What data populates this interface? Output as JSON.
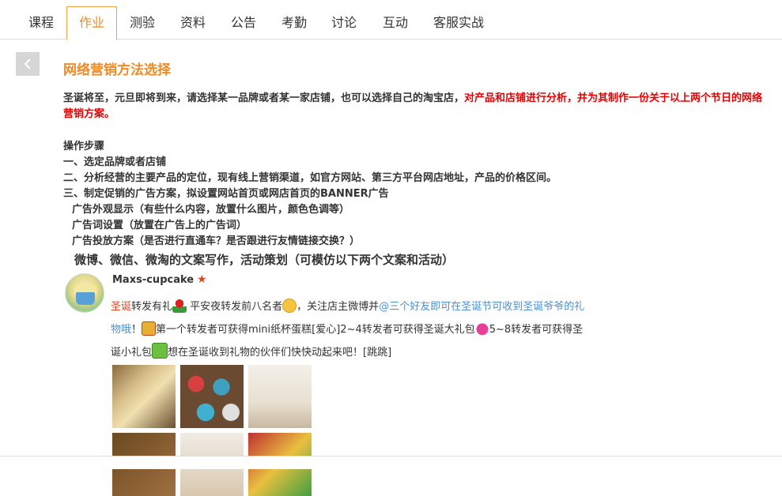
{
  "tabs": [
    "课程",
    "作业",
    "测验",
    "资料",
    "公告",
    "考勤",
    "讨论",
    "互动",
    "客服实战"
  ],
  "active_tab": "作业",
  "title": "网络营销方法选择",
  "intro": {
    "text": "圣诞将至，元旦即将到来，请选择某一品牌或者某一家店铺，也可以选择自己的淘宝店，",
    "highlight": "对产品和店铺进行分析，并为其制作一份关于以上两个节日的网络营销方案。"
  },
  "steps": {
    "heading": "操作步骤",
    "items": [
      "一、选定品牌或者店铺",
      "二、分析经营的主要产品的定位，现有线上营销渠道，如官方网站、第三方平台网店地址，产品的价格区间。",
      "三、制定促销的广告方案，拟设置网站首页或网店首页的BANNER广告"
    ],
    "sub_items": [
      "广告外观显示（有些什么内容，放置什么图片，颜色色调等）",
      "广告词设置（放置在广告上的广告词）",
      "广告投放方案（是否进行直通车？是否跟进行友情链接交换？）"
    ],
    "big_item": "微博、微信、微淘的文案写作，活动策划（可模仿以下两个文案和活动）"
  },
  "post": {
    "username": "Maxs-cupcake",
    "star": "★",
    "tag": "圣诞",
    "t1": "转发有礼",
    "t2": " 平安夜转发前八名者",
    "t3": "，关注店主微博并",
    "link": "@三个好友即可在圣诞节可收到圣诞爷爷的礼物哦",
    "t4": "！",
    "t5": "第一个转发者可获得mini纸杯蛋糕[爱心]2~4转发者可获得圣诞大礼包",
    "t6": "5~8转发者可获得圣诞小礼包",
    "t7": "想在圣诞收到礼物的伙伴们快快动起来吧！[跳跳]"
  },
  "colors": {
    "accent": "#f08a24",
    "highlight_red": "#e60000",
    "link_blue": "#4a90d0",
    "tag_red": "#e8401c"
  },
  "icons": {
    "back": "chevron-left-icon",
    "star": "star-icon"
  }
}
